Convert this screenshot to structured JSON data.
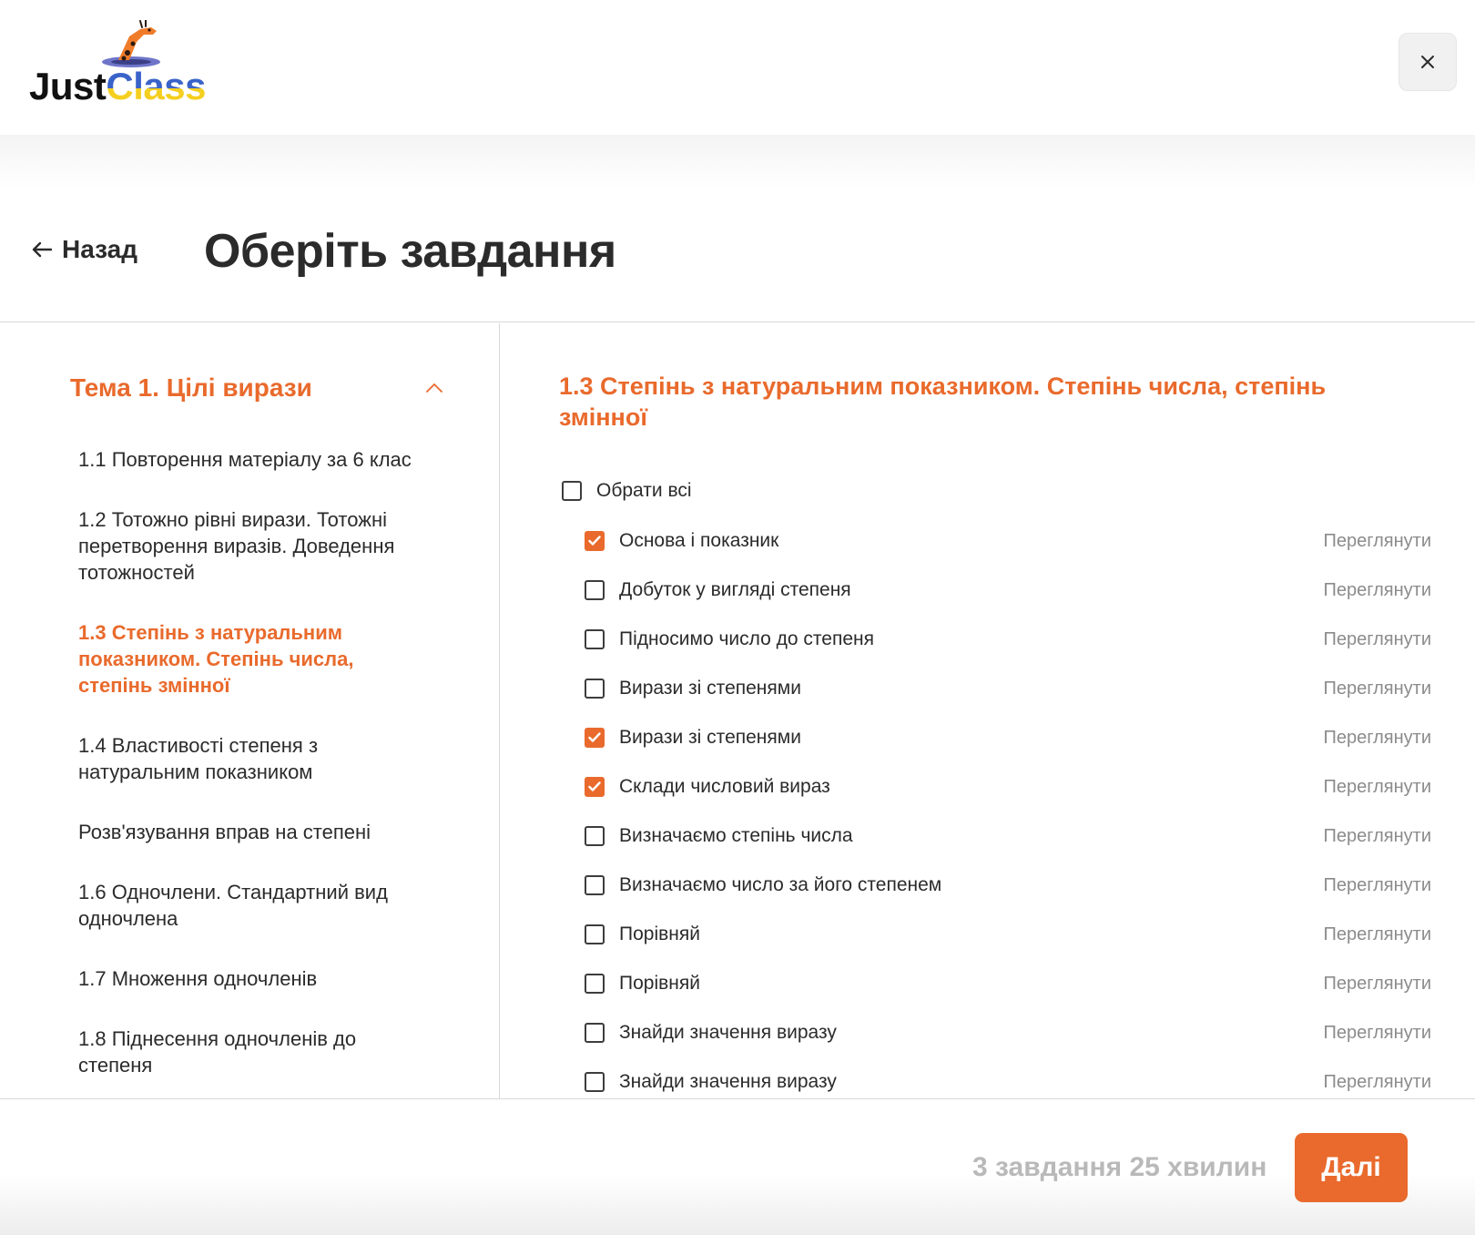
{
  "header": {
    "logo_just": "Just",
    "logo_class": "Class",
    "close_icon": "close-icon"
  },
  "titlebar": {
    "back_label": "Назад",
    "back_icon": "arrow-left-icon",
    "title": "Оберіть завдання"
  },
  "sidebar": {
    "topic": "Тема 1. Цілі вирази",
    "topic_icon": "chevron-up-icon",
    "lessons": [
      {
        "label": "1.1 Повторення матеріалу за 6 клас",
        "active": false
      },
      {
        "label": "1.2 Тотожно рівні вирази. Тотожні перетворення виразів. Доведення тотожностей",
        "active": false
      },
      {
        "label": "1.3 Степінь з натуральним показником. Степінь числа, степінь змінної",
        "active": true
      },
      {
        "label": "1.4 Властивості степеня з натуральним показником",
        "active": false
      },
      {
        "label": "Розв'язування вправ на степені",
        "active": false
      },
      {
        "label": "1.6 Одночлени. Стандартний вид одночлена",
        "active": false
      },
      {
        "label": "1.7 Множення одночленів",
        "active": false
      },
      {
        "label": "1.8 Піднесення одночленів до степеня",
        "active": false
      }
    ]
  },
  "main": {
    "section_title": "1.3 Степінь з натуральним показником. Степінь числа, степінь змінної",
    "select_all_label": "Обрати всі",
    "select_all_checked": false,
    "tasks": [
      {
        "label": "Основа і показник",
        "checked": true,
        "view": "Переглянути"
      },
      {
        "label": "Добуток у вигляді степеня",
        "checked": false,
        "view": "Переглянути"
      },
      {
        "label": "Підносимо число до степеня",
        "checked": false,
        "view": "Переглянути"
      },
      {
        "label": "Вирази зі степенями",
        "checked": false,
        "view": "Переглянути"
      },
      {
        "label": "Вирази зі степенями",
        "checked": true,
        "view": "Переглянути"
      },
      {
        "label": "Склади числовий вираз",
        "checked": true,
        "view": "Переглянути"
      },
      {
        "label": "Визначаємо степінь числа",
        "checked": false,
        "view": "Переглянути"
      },
      {
        "label": "Визначаємо число за його степенем",
        "checked": false,
        "view": "Переглянути"
      },
      {
        "label": "Порівняй",
        "checked": false,
        "view": "Переглянути"
      },
      {
        "label": "Порівняй",
        "checked": false,
        "view": "Переглянути"
      },
      {
        "label": "Знайди значення виразу",
        "checked": false,
        "view": "Переглянути"
      },
      {
        "label": "Знайди значення виразу",
        "checked": false,
        "view": "Переглянути"
      }
    ]
  },
  "footer": {
    "summary": "3 завдання 25 хвилин",
    "next_label": "Далі"
  },
  "colors": {
    "accent": "#e96a2c",
    "text": "#2b2b2b",
    "muted": "#8b8b8b",
    "logo_blue": "#3a63c9",
    "logo_yellow": "#f5cf1f"
  }
}
